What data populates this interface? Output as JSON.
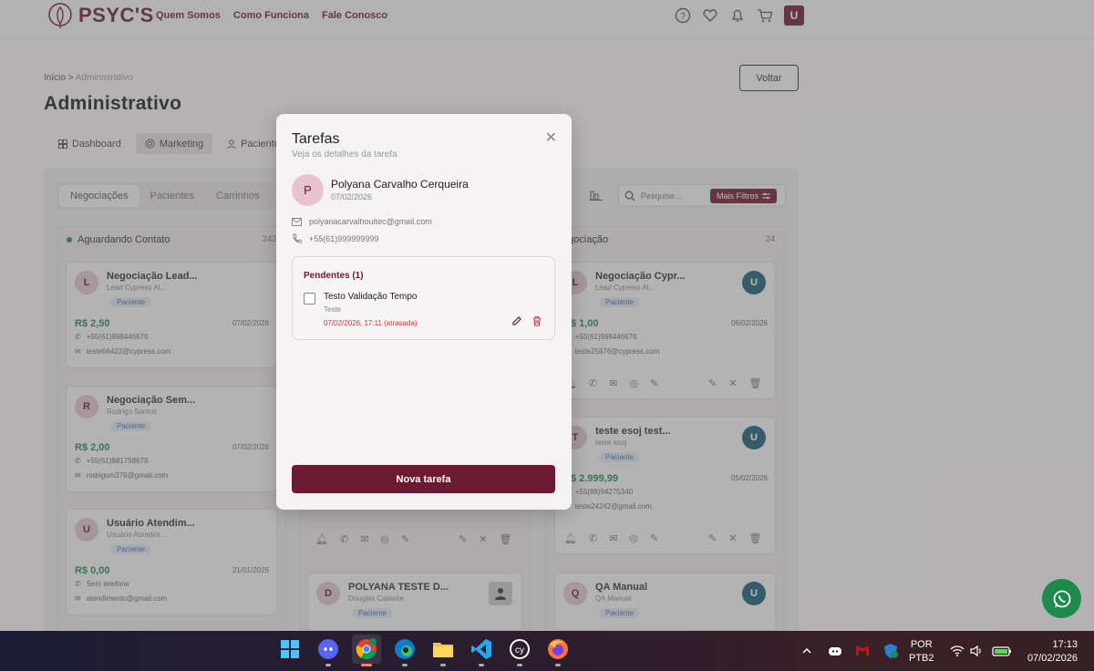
{
  "header": {
    "brand": "PSYC'S",
    "nav": [
      "Quem Somos",
      "Como Funciona",
      "Fale Conosco"
    ],
    "avatar_letter": "U"
  },
  "breadcrumb": {
    "home": "Início",
    "sep": ">",
    "current": "Administrativo"
  },
  "page_title": "Administrativo",
  "back_button": "Voltar",
  "tabs": [
    "Dashboard",
    "Marketing",
    "Pacientes"
  ],
  "subtabs": [
    "Negociações",
    "Pacientes",
    "Carrinhos"
  ],
  "search": {
    "placeholder": "Pesquise...",
    "filters_button": "Mais Filtros"
  },
  "columns": [
    {
      "title": "Aguardando Contato",
      "count": "242"
    },
    {
      "title": "Negociação",
      "count": "24"
    }
  ],
  "cards_left": [
    {
      "initial": "L",
      "title": "Negociação Lead...",
      "sub": "Lead Cypress Al...",
      "badge": "Paciente",
      "value": "R$ 2,50",
      "date": "07/02/2026",
      "phone": "+55(61)998446676",
      "email": "teste66422@cypress.com"
    },
    {
      "initial": "R",
      "title": "Negociação Sem...",
      "sub": "Rodrigo Santos",
      "badge": "Paciente",
      "value": "R$ 2,00",
      "date": "07/02/2026",
      "phone": "+55(61)981758678",
      "email": "rodrigum376@gmail.com"
    },
    {
      "initial": "U",
      "title": "Usuário Atendim...",
      "sub": "Usuário Atendim...",
      "badge": "Paciente",
      "value": "R$ 0,00",
      "date": "21/01/2026",
      "phone": "Sem telefone",
      "email": "atendimento@gmail.com"
    }
  ],
  "card_middle": {
    "initial": "D",
    "title": "POLYANA TESTE D...",
    "sub": "Douglas Caleebe",
    "badge": "Paciente"
  },
  "cards_right": [
    {
      "initial": "L",
      "title": "Negociação Cypr...",
      "sub": "Lead Cypress Al...",
      "badge": "Paciente",
      "value": "R$ 1,00",
      "date": "06/02/2026",
      "phone": "+55(61)998446676",
      "email": "teste25676@cypress.com",
      "owner": "U"
    },
    {
      "initial": "T",
      "title": "teste esoj test...",
      "sub": "teste esoj",
      "badge": "Paciente",
      "value": "R$ 2.999,99",
      "date": "05/02/2026",
      "phone": "+55(88)94275340",
      "email": "teste24242@gmail.com",
      "owner": "U"
    },
    {
      "initial": "Q",
      "title": "QA Manual",
      "sub": "QA Manual",
      "badge": "Paciente",
      "owner": "U"
    }
  ],
  "modal": {
    "title": "Tarefas",
    "subtitle": "Veja os detalhes da tarefa",
    "contact": {
      "initial": "P",
      "name": "Polyana Carvalho Cerqueira",
      "date": "07/02/2026",
      "email": "polyanacarvalhouitec@gmail.com",
      "phone": "+55(61)999999999"
    },
    "pending_header": "Pendentes (1)",
    "task": {
      "title": "Testo Validação Tempo",
      "description": "Teste",
      "due": "07/02/2026, 17:11 (atrasada)"
    },
    "new_task_button": "Nova tarefa"
  },
  "taskbar": {
    "lang_1": "POR",
    "lang_2": "PTB2",
    "time": "17:13",
    "date": "07/02/2026"
  },
  "colors": {
    "brand": "#6b1a32",
    "money": "#1e8a4b",
    "avatar_blue": "#1a5d75",
    "overdue": "#dd3333"
  }
}
